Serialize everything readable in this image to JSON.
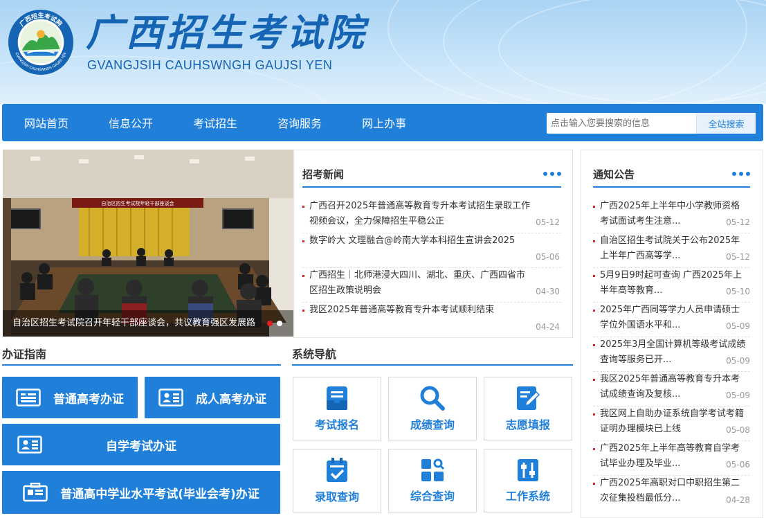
{
  "header": {
    "title": "广西招生考试院",
    "subtitle": "GVANGJSIH CAUHSWNGH GAUJSI YEN",
    "seal_text": "广西招生考试院",
    "seal_latin": "GVANGJSIH CAUHSWNGH GAUJSI YEN"
  },
  "nav": {
    "items": [
      "网站首页",
      "信息公开",
      "考试招生",
      "咨询服务",
      "网上办事"
    ]
  },
  "search": {
    "placeholder": "点击输入您要搜索的信息",
    "button_label": "全站搜索"
  },
  "carousel": {
    "caption": "自治区招生考试院召开年轻干部座谈会，共议教育强区发展路",
    "banner_text": "自治区招生考试院年轻干部座谈会",
    "slide_count": 2,
    "active_index": 0
  },
  "news": {
    "title": "招考新闻",
    "items": [
      {
        "text": "广西召开2025年普通高等教育专升本考试招生录取工作视频会议，全力保障招生平稳公正",
        "date": "05-12"
      },
      {
        "text": "数字岭大 文理融合@岭南大学本科招生宣讲会2025",
        "date": "05-06"
      },
      {
        "text": "广西招生｜北师港浸大四川、湖北、重庆、广西四省市区招生政策说明会",
        "date": "04-30"
      },
      {
        "text": "我区2025年普通高等教育专升本考试顺利结束",
        "date": "04-24"
      }
    ]
  },
  "notices": {
    "title": "通知公告",
    "items": [
      {
        "text": "广西2025年上半年中小学教师资格考试面试考生注意...",
        "date": "05-12"
      },
      {
        "text": "自治区招生考试院关于公布2025年上半年广西高等学...",
        "date": "05-12"
      },
      {
        "text": "5月9日9时起可查询 广西2025年上半年高等教育...",
        "date": "05-10"
      },
      {
        "text": "2025年广西同等学力人员申请硕士学位外国语水平和...",
        "date": "05-09"
      },
      {
        "text": "2025年3月全国计算机等级考试成绩查询等服务已开...",
        "date": "05-09"
      },
      {
        "text": "我区2025年普通高等教育专升本考试成绩查询及复核...",
        "date": "05-09"
      },
      {
        "text": "我区网上自助办证系统自学考试考籍证明办理模块已上线",
        "date": "05-08"
      },
      {
        "text": "广西2025年上半年高等教育自学考试毕业办理及毕业...",
        "date": "05-06"
      },
      {
        "text": "广西2025年高职对口中职招生第二次征集投档最低分...",
        "date": "04-28"
      }
    ]
  },
  "guide": {
    "title": "办证指南",
    "buttons": [
      "普通高考办证",
      "成人高考办证",
      "自学考试办证",
      "普通高中学业水平考试(毕业会考)办证"
    ]
  },
  "system_nav": {
    "title": "系统导航",
    "tiles": [
      {
        "label": "考试报名",
        "icon": "document-icon"
      },
      {
        "label": "成绩查询",
        "icon": "search-icon"
      },
      {
        "label": "志愿填报",
        "icon": "edit-icon"
      },
      {
        "label": "录取查询",
        "icon": "clipboard-check-icon"
      },
      {
        "label": "综合查询",
        "icon": "grid-search-icon"
      },
      {
        "label": "工作系统",
        "icon": "sliders-icon"
      }
    ]
  },
  "colors": {
    "primary": "#1f7fd9",
    "title_blue": "#1565b4",
    "accent_red": "#e02020"
  }
}
